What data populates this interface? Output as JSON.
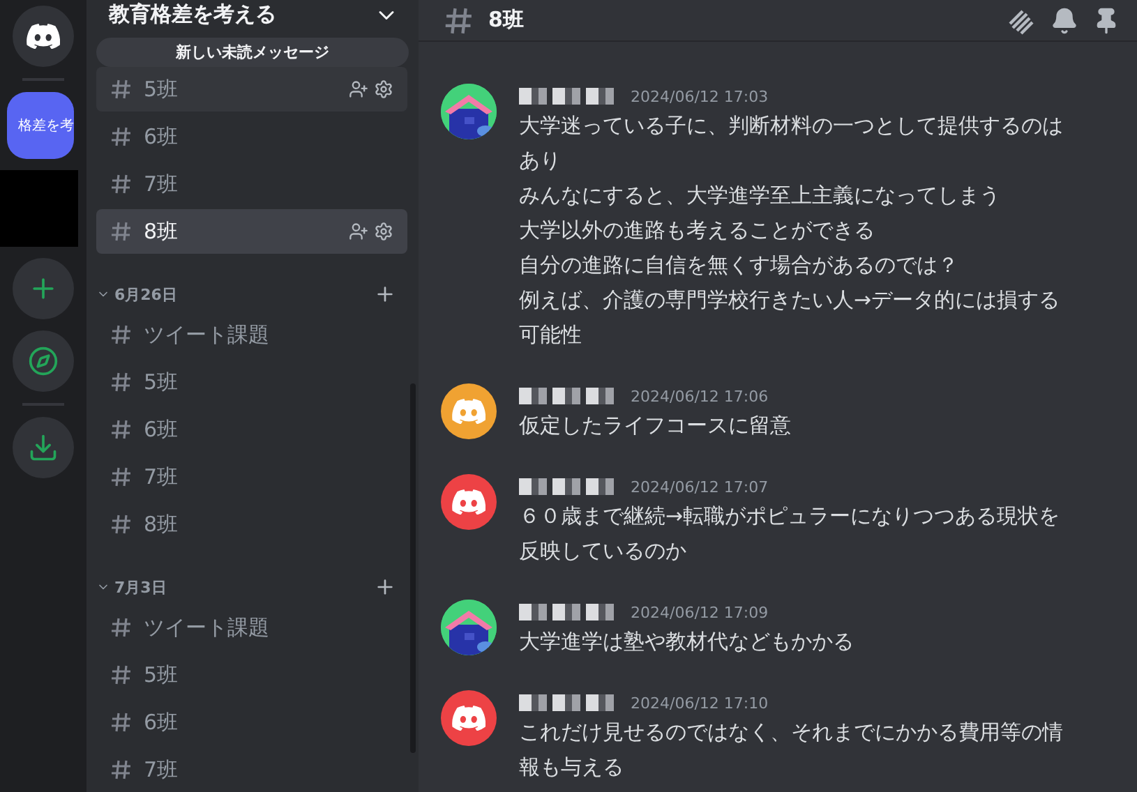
{
  "server_rail": {
    "items": [
      {
        "kind": "home"
      },
      {
        "kind": "server",
        "label": "格差を考",
        "selected": true
      },
      {
        "kind": "hidden"
      },
      {
        "kind": "add"
      },
      {
        "kind": "explore"
      },
      {
        "kind": "download"
      }
    ]
  },
  "sidebar": {
    "title": "教育格差を考える",
    "unread_banner": "新しい未読メッセージ",
    "channels": [
      {
        "name": "5班",
        "selected": false,
        "hovered": true
      },
      {
        "name": "6班",
        "selected": false,
        "hovered": false
      },
      {
        "name": "7班",
        "selected": false,
        "hovered": false
      },
      {
        "name": "8班",
        "selected": true,
        "hovered": false
      }
    ],
    "categories": [
      {
        "name": "6月26日",
        "expanded": true,
        "channels": [
          {
            "name": "ツイート課題",
            "selected": false
          },
          {
            "name": "5班",
            "selected": false
          },
          {
            "name": "6班",
            "selected": false
          },
          {
            "name": "7班",
            "selected": false
          },
          {
            "name": "8班",
            "selected": false
          }
        ]
      },
      {
        "name": "7月3日",
        "expanded": true,
        "channels": [
          {
            "name": "ツイート課題",
            "selected": false
          },
          {
            "name": "5班",
            "selected": false
          },
          {
            "name": "6班",
            "selected": false
          },
          {
            "name": "7班",
            "selected": false
          }
        ]
      }
    ]
  },
  "chat": {
    "channel": "8班",
    "messages": [
      {
        "kind": "picture",
        "time": "2024/06/12 17:03",
        "lines": [
          "大学迷っている子に、判断材料の一つとして提供するのはあり",
          "みんなにすると、大学進学至上主義になってしまう",
          "大学以外の進路も考えることができる",
          "自分の進路に自信を無くす場合があるのでは？",
          "例えば、介護の専門学校行きたい人→データ的には損する可能性"
        ]
      },
      {
        "kind": "default",
        "color": "#f0a232",
        "time": "2024/06/12 17:06",
        "lines": [
          "仮定したライフコースに留意"
        ]
      },
      {
        "kind": "default",
        "color": "#ed4245",
        "time": "2024/06/12 17:07",
        "lines": [
          "６０歳まで継続→転職がポピュラーになりつつある現状を反映しているのか"
        ]
      },
      {
        "kind": "picture",
        "time": "2024/06/12 17:09",
        "lines": [
          "大学進学は塾や教材代などもかかる"
        ]
      },
      {
        "kind": "default",
        "color": "#ed4245",
        "time": "2024/06/12 17:10",
        "lines": [
          "これだけ見せるのではなく、それまでにかかる費用等の情報も与える"
        ]
      }
    ]
  }
}
